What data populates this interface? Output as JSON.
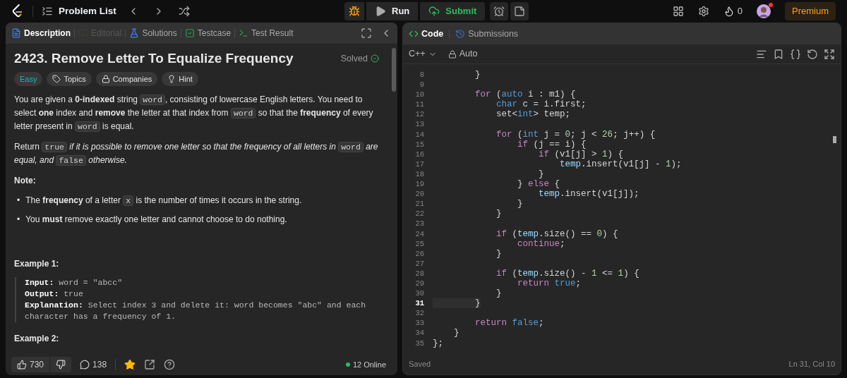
{
  "top_bar": {
    "problem_list": "Problem List",
    "run": "Run",
    "submit": "Submit",
    "streak": "0",
    "premium": "Premium",
    "avatar_notification": true
  },
  "left_panel": {
    "tabs": [
      {
        "label": "Description",
        "kind": "description",
        "selected": true,
        "disabled": false
      },
      {
        "label": "Editorial",
        "kind": "editorial",
        "selected": false,
        "disabled": true
      },
      {
        "label": "Solutions",
        "kind": "solutions",
        "selected": false,
        "disabled": false
      },
      {
        "label": "Testcase",
        "kind": "testcase",
        "selected": false,
        "disabled": false
      },
      {
        "label": "Test Result",
        "kind": "result",
        "selected": false,
        "disabled": false
      }
    ],
    "title": "2423. Remove Letter To Equalize Frequency",
    "status": "Solved",
    "chips": [
      {
        "label": "Easy",
        "kind": "difficulty"
      },
      {
        "label": "Topics",
        "kind": "tag"
      },
      {
        "label": "Companies",
        "kind": "lock"
      },
      {
        "label": "Hint",
        "kind": "bulb"
      }
    ],
    "paragraphs": [
      [
        {
          "t": "You are given a **0-indexed** string ",
          "kind": "text"
        },
        {
          "t": "word",
          "kind": "code"
        },
        {
          "t": ", consisting of lowercase English letters. You need to select **one** index and **remove** the letter at that index from ",
          "kind": "text"
        },
        {
          "t": "word",
          "kind": "code"
        },
        {
          "t": " so that the **frequency** of every letter present in ",
          "kind": "text"
        },
        {
          "t": "word",
          "kind": "code"
        },
        {
          "t": " is equal.",
          "kind": "text"
        }
      ],
      [
        {
          "t": "Return ",
          "kind": "text"
        },
        {
          "t": "true",
          "kind": "code"
        },
        {
          "t": " *if it is possible to remove one letter so that the frequency of all letters in* ",
          "kind": "text"
        },
        {
          "t": "word",
          "kind": "code"
        },
        {
          "t": " *are equal, and* ",
          "kind": "text"
        },
        {
          "t": "false",
          "kind": "code"
        },
        {
          "t": " *otherwise.*",
          "kind": "text"
        }
      ]
    ],
    "note_heading": "Note:",
    "notes": [
      {
        "marker": "•",
        "segs": [
          {
            "t": "The **frequency** of a letter ",
            "kind": "text"
          },
          {
            "t": "x",
            "kind": "code"
          },
          {
            "t": " is the number of times it occurs in the string.",
            "kind": "text"
          }
        ]
      },
      {
        "marker": "•",
        "segs": [
          {
            "t": "You **must** remove exactly one letter and cannot choose to do nothing.",
            "kind": "text"
          }
        ]
      }
    ],
    "example_1": {
      "heading": "Example 1:",
      "lines": [
        [
          {
            "t": "Input:",
            "kind": "label"
          },
          {
            "t": " word = \"abcc\"",
            "kind": "value"
          }
        ],
        [
          {
            "t": "Output:",
            "kind": "label"
          },
          {
            "t": " true",
            "kind": "value"
          }
        ],
        [
          {
            "t": "Explanation:",
            "kind": "label"
          },
          {
            "t": " Select index 3 and delete it: word becomes \"abc\" and each character has a frequency of 1.",
            "kind": "value"
          }
        ]
      ]
    },
    "example_2": {
      "heading": "Example 2:"
    },
    "footer": {
      "likes": "730",
      "comments": "138",
      "favorited": true,
      "online": "12 Online"
    }
  },
  "right_panel": {
    "tabs": [
      {
        "label": "Code",
        "selected": true
      },
      {
        "label": "Submissions",
        "selected": false
      }
    ],
    "language": "C++",
    "mode": "Auto",
    "code_lines": [
      {
        "n": "8",
        "current": false,
        "tokens": [
          {
            "t": "        }",
            "kind": "p"
          }
        ]
      },
      {
        "n": "9",
        "current": false
      },
      {
        "n": "10",
        "current": false,
        "tokens": [
          {
            "t": "        for",
            "kind": "kw"
          },
          {
            "t": " (",
            "kind": "p"
          },
          {
            "t": "auto",
            "kind": "ty"
          },
          {
            "t": " i : m1) {",
            "kind": "p"
          }
        ]
      },
      {
        "n": "11",
        "current": false,
        "tokens": [
          {
            "t": "            char",
            "kind": "ty"
          },
          {
            "t": " c = i.first;",
            "kind": "p"
          }
        ]
      },
      {
        "n": "12",
        "current": false,
        "tokens": [
          {
            "t": "            set<",
            "kind": "p"
          },
          {
            "t": "int",
            "kind": "ty"
          },
          {
            "t": "> temp;",
            "kind": "p"
          }
        ]
      },
      {
        "n": "13",
        "current": false
      },
      {
        "n": "14",
        "current": false,
        "tokens": [
          {
            "t": "            for",
            "kind": "kw"
          },
          {
            "t": " (",
            "kind": "p"
          },
          {
            "t": "int",
            "kind": "ty"
          },
          {
            "t": " j = ",
            "kind": "p"
          },
          {
            "t": "0",
            "kind": "num"
          },
          {
            "t": "; j < ",
            "kind": "p"
          },
          {
            "t": "26",
            "kind": "num"
          },
          {
            "t": "; j++) {",
            "kind": "p"
          }
        ]
      },
      {
        "n": "15",
        "current": false,
        "tokens": [
          {
            "t": "                if",
            "kind": "kw"
          },
          {
            "t": " (j == i) {",
            "kind": "p"
          }
        ]
      },
      {
        "n": "16",
        "current": false,
        "tokens": [
          {
            "t": "                    if",
            "kind": "kw"
          },
          {
            "t": " (v1[j] > ",
            "kind": "p"
          },
          {
            "t": "1",
            "kind": "num"
          },
          {
            "t": ") {",
            "kind": "p"
          }
        ]
      },
      {
        "n": "17",
        "current": false,
        "tokens": [
          {
            "t": "                        temp",
            "kind": "var"
          },
          {
            "t": ".insert(v1[j] - ",
            "kind": "p"
          },
          {
            "t": "1",
            "kind": "num"
          },
          {
            "t": ");",
            "kind": "p"
          }
        ]
      },
      {
        "n": "18",
        "current": false,
        "tokens": [
          {
            "t": "                    }",
            "kind": "p"
          }
        ]
      },
      {
        "n": "19",
        "current": false,
        "tokens": [
          {
            "t": "                } ",
            "kind": "p"
          },
          {
            "t": "else",
            "kind": "kw"
          },
          {
            "t": " {",
            "kind": "p"
          }
        ]
      },
      {
        "n": "20",
        "current": false,
        "tokens": [
          {
            "t": "                    temp",
            "kind": "var"
          },
          {
            "t": ".insert(v1[j]);",
            "kind": "p"
          }
        ]
      },
      {
        "n": "21",
        "current": false,
        "tokens": [
          {
            "t": "                }",
            "kind": "p"
          }
        ]
      },
      {
        "n": "22",
        "current": false,
        "tokens": [
          {
            "t": "            }",
            "kind": "p"
          }
        ]
      },
      {
        "n": "23",
        "current": false
      },
      {
        "n": "24",
        "current": false,
        "tokens": [
          {
            "t": "            if",
            "kind": "kw"
          },
          {
            "t": " (",
            "kind": "p"
          },
          {
            "t": "temp",
            "kind": "var"
          },
          {
            "t": ".size() == ",
            "kind": "p"
          },
          {
            "t": "0",
            "kind": "num"
          },
          {
            "t": ") {",
            "kind": "p"
          }
        ]
      },
      {
        "n": "25",
        "current": false,
        "tokens": [
          {
            "t": "                continue",
            "kind": "kw"
          },
          {
            "t": ";",
            "kind": "p"
          }
        ]
      },
      {
        "n": "26",
        "current": false,
        "tokens": [
          {
            "t": "            }",
            "kind": "p"
          }
        ]
      },
      {
        "n": "27",
        "current": false
      },
      {
        "n": "28",
        "current": false,
        "tokens": [
          {
            "t": "            if",
            "kind": "kw"
          },
          {
            "t": " (",
            "kind": "p"
          },
          {
            "t": "temp",
            "kind": "var"
          },
          {
            "t": ".size() - ",
            "kind": "p"
          },
          {
            "t": "1",
            "kind": "num"
          },
          {
            "t": " <= ",
            "kind": "p"
          },
          {
            "t": "1",
            "kind": "num"
          },
          {
            "t": ") {",
            "kind": "p"
          }
        ]
      },
      {
        "n": "29",
        "current": false,
        "tokens": [
          {
            "t": "                return",
            "kind": "kw"
          },
          {
            "t": " true",
            "kind": "ty"
          },
          {
            "t": ";",
            "kind": "p"
          }
        ]
      },
      {
        "n": "30",
        "current": false,
        "tokens": [
          {
            "t": "            }",
            "kind": "p"
          }
        ]
      },
      {
        "n": "31",
        "current": true,
        "tokens": [
          {
            "t": "        }",
            "kind": "p"
          }
        ]
      },
      {
        "n": "32",
        "current": false
      },
      {
        "n": "33",
        "current": false,
        "tokens": [
          {
            "t": "        return",
            "kind": "kw"
          },
          {
            "t": " false",
            "kind": "ty"
          },
          {
            "t": ";",
            "kind": "p"
          }
        ]
      },
      {
        "n": "34",
        "current": false,
        "tokens": [
          {
            "t": "    }",
            "kind": "p"
          }
        ]
      },
      {
        "n": "35",
        "current": false,
        "tokens": [
          {
            "t": "};",
            "kind": "p"
          }
        ]
      }
    ],
    "status": "Saved",
    "cursor": "Ln 31, Col 10"
  }
}
